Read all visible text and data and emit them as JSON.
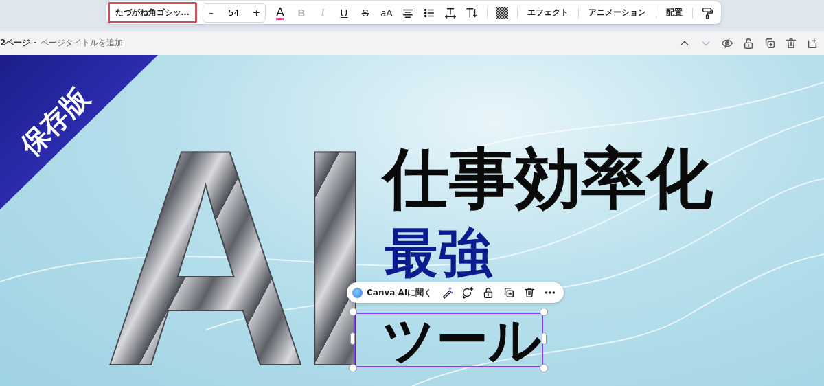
{
  "toolbar": {
    "font_field": {
      "value": "たづがね角ゴシッ…",
      "highlighted": true
    },
    "font_size": {
      "minus": "–",
      "value": "54",
      "plus": "+"
    },
    "format_buttons": [
      {
        "kind": "color",
        "label": "A",
        "disabled": false
      },
      {
        "kind": "bold",
        "label": "B",
        "disabled": true
      },
      {
        "kind": "italic",
        "label": "I",
        "disabled": true
      },
      {
        "kind": "underline",
        "label": "U",
        "disabled": false
      },
      {
        "kind": "strike",
        "label": "S",
        "disabled": false
      },
      {
        "kind": "case",
        "label": "aA",
        "disabled": false
      },
      {
        "kind": "align",
        "disabled": false
      },
      {
        "kind": "list",
        "disabled": false
      },
      {
        "kind": "spacing",
        "disabled": false
      },
      {
        "kind": "line_height",
        "disabled": false
      }
    ],
    "transparency": true,
    "menu_buttons": [
      "エフェクト",
      "アニメーション",
      "配置"
    ],
    "paint_format": true
  },
  "page_header": {
    "page_label": "2ページ -",
    "title_placeholder": "ページタイトルを追加",
    "actions": [
      {
        "kind": "up",
        "disabled": false
      },
      {
        "kind": "down",
        "disabled": true
      },
      {
        "kind": "hide",
        "disabled": false
      },
      {
        "kind": "lock",
        "disabled": false
      },
      {
        "kind": "duplicate",
        "disabled": false
      },
      {
        "kind": "delete",
        "disabled": false
      },
      {
        "kind": "add",
        "disabled": false
      }
    ]
  },
  "canvas": {
    "ribbon": "保存版",
    "big_letters": "AI",
    "headline": "仕事効率化",
    "accent": "最強",
    "selected_text": {
      "text": "ツール",
      "selected": true
    },
    "floating_menu": {
      "ask_ai": "Canva AIに聞く",
      "actions": [
        {
          "kind": "magic"
        },
        {
          "kind": "comment"
        },
        {
          "kind": "lock"
        },
        {
          "kind": "duplicate"
        },
        {
          "kind": "delete"
        },
        {
          "kind": "more"
        }
      ]
    }
  }
}
